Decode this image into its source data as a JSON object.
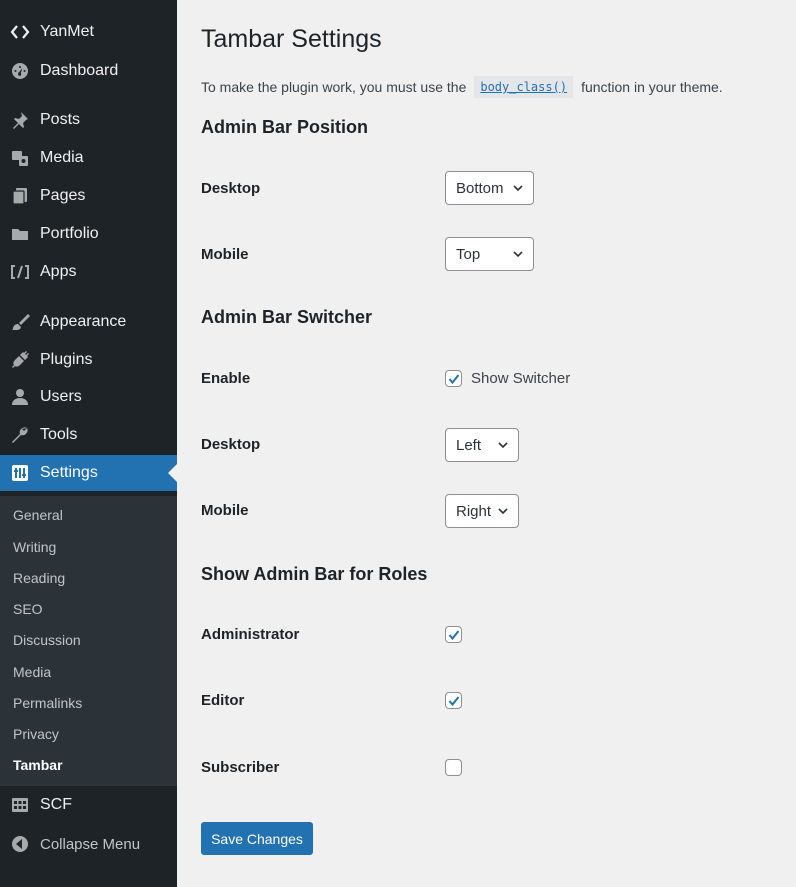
{
  "sidebar": {
    "site_name": "YanMet",
    "items": [
      {
        "label": "Dashboard",
        "icon": "dashboard-icon"
      },
      {
        "label": "Posts",
        "icon": "pin-icon"
      },
      {
        "label": "Media",
        "icon": "media-icon"
      },
      {
        "label": "Pages",
        "icon": "pages-icon"
      },
      {
        "label": "Portfolio",
        "icon": "folder-icon"
      },
      {
        "label": "Apps",
        "icon": "code-icon"
      },
      {
        "label": "Appearance",
        "icon": "brush-icon"
      },
      {
        "label": "Plugins",
        "icon": "plug-icon"
      },
      {
        "label": "Users",
        "icon": "user-icon"
      },
      {
        "label": "Tools",
        "icon": "wrench-icon"
      },
      {
        "label": "Settings",
        "icon": "settings-icon"
      }
    ],
    "submenu": [
      "General",
      "Writing",
      "Reading",
      "SEO",
      "Discussion",
      "Media",
      "Permalinks",
      "Privacy",
      "Tambar"
    ],
    "scf_label": "SCF",
    "collapse_label": "Collapse Menu"
  },
  "main": {
    "title": "Tambar Settings",
    "intro_before": "To make the plugin work, you must use the",
    "intro_code": "body_class()",
    "intro_after": "function in your theme.",
    "position_section": {
      "title": "Admin Bar Position",
      "desktop_label": "Desktop",
      "desktop_value": "Bottom",
      "mobile_label": "Mobile",
      "mobile_value": "Top"
    },
    "switcher_section": {
      "title": "Admin Bar Switcher",
      "enable_label": "Enable",
      "enable_checkbox_label": "Show Switcher",
      "enable_checked": true,
      "desktop_label": "Desktop",
      "desktop_value": "Left",
      "mobile_label": "Mobile",
      "mobile_value": "Right"
    },
    "roles_section": {
      "title": "Show Admin Bar for Roles",
      "roles": [
        {
          "label": "Administrator",
          "checked": true
        },
        {
          "label": "Editor",
          "checked": true
        },
        {
          "label": "Subscriber",
          "checked": false
        }
      ]
    },
    "save_button": "Save Changes"
  },
  "colors": {
    "sidebar_bg": "#1d2327",
    "submenu_bg": "#2c3338",
    "accent": "#2271b1",
    "page_bg": "#f0f0f1"
  }
}
